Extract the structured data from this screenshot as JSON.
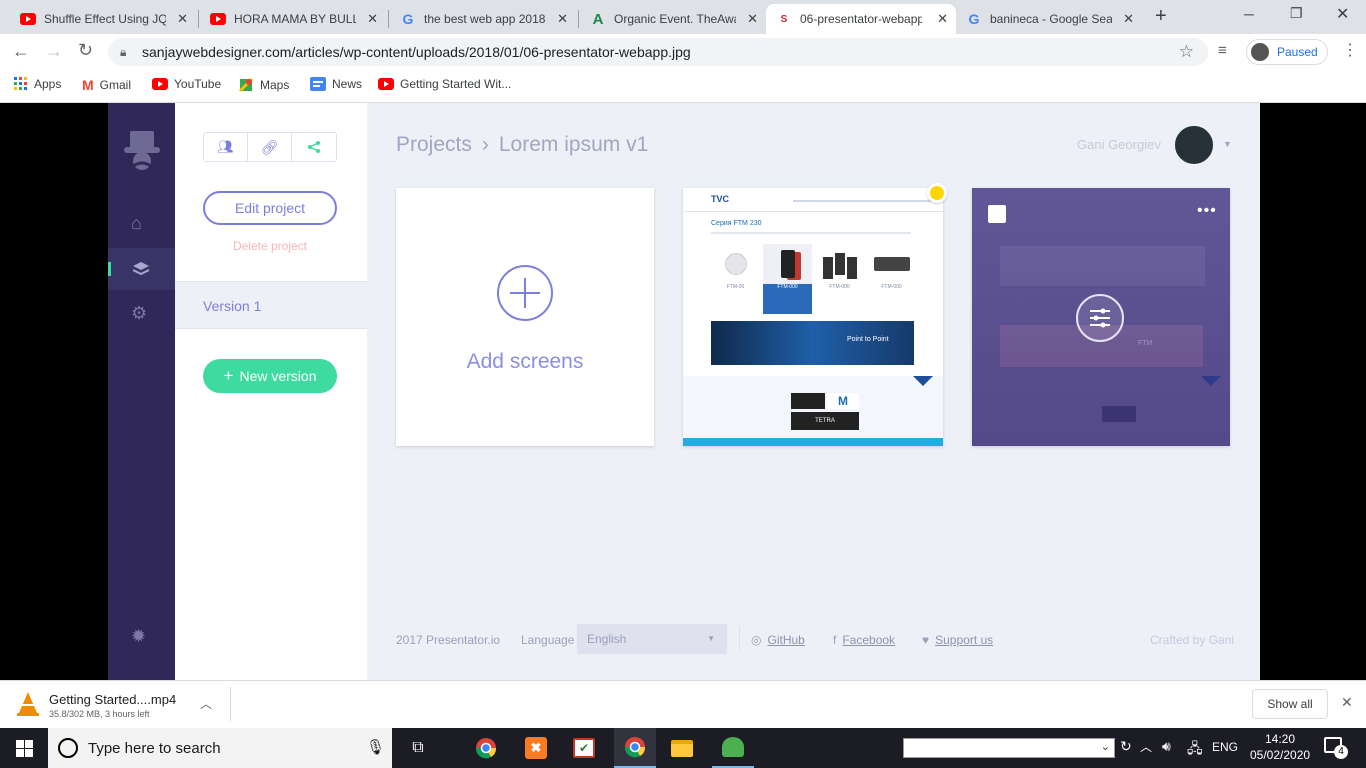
{
  "tabs": [
    {
      "title": "Shuffle Effect Using JQuery",
      "icon": "youtube-icon"
    },
    {
      "title": "HORA MAMA BY BULL D",
      "icon": "youtube-icon"
    },
    {
      "title": "the best web app 2018",
      "icon": "google-icon"
    },
    {
      "title": "Organic Event. TheAwa",
      "icon": "a-logo-icon"
    },
    {
      "title": "06-presentator-webapp",
      "icon": "s-logo-icon"
    },
    {
      "title": "banineca - Google Sear",
      "icon": "google-icon"
    }
  ],
  "browser": {
    "url": "sanjaywebdesigner.com/articles/wp-content/uploads/2018/01/06-presentator-webapp.jpg",
    "profile_label": "Paused",
    "new_tab": "+"
  },
  "bookmarks": [
    "Apps",
    "Gmail",
    "YouTube",
    "Maps",
    "News",
    "Getting Started Wit..."
  ],
  "app": {
    "breadcrumb_root": "Projects",
    "breadcrumb_sep": "›",
    "breadcrumb_current": "Lorem ipsum v1",
    "user_name": "Gani Georgiev",
    "edit_project": "Edit project",
    "delete_project": "Delete project",
    "version_label": "Version 1",
    "new_version": "New version",
    "add_screens": "Add screens",
    "accent": "#7b7fdb",
    "green": "#3ddba0",
    "sidebar_color": "#2f2858"
  },
  "thumb1": {
    "brand": "TVC",
    "heading": "Серия FTM 230",
    "items": [
      "FTM-00",
      "FTM-000",
      "FTM-000",
      "FTM-000"
    ],
    "banner_title": "Point to Point",
    "tetra": "TETRA"
  },
  "thumb2": {
    "banner_title": "FTM"
  },
  "footer": {
    "copyright": "2017 Presentator.io",
    "language_label": "Language",
    "language_value": "English",
    "github": "GitHub",
    "facebook": "Facebook",
    "support": "Support us",
    "crafted": "Crafted by Gani"
  },
  "download": {
    "filename": "Getting Started....mp4",
    "status": "35.8/302 MB, 3 hours left",
    "show_all": "Show all"
  },
  "taskbar": {
    "search_placeholder": "Type here to search",
    "lang": "ENG",
    "time": "14:20",
    "date": "05/02/2020",
    "notifications": "4"
  }
}
